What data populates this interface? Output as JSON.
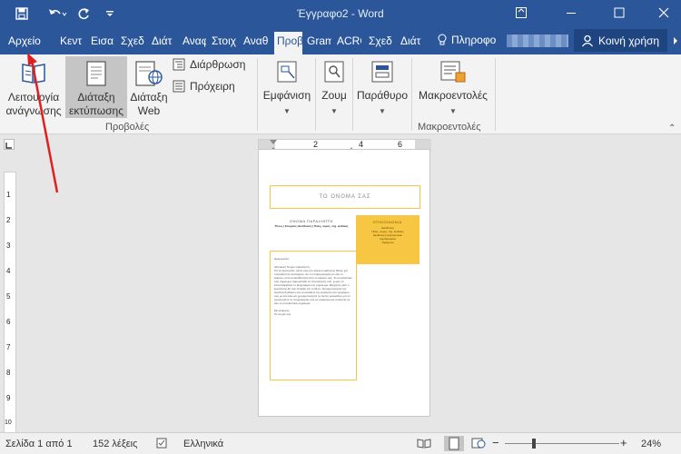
{
  "window": {
    "title": "Έγγραφο2 - Word"
  },
  "tabs": [
    "Αρχείο",
    "Κεντ",
    "Εισα",
    "Σχεδ",
    "Διάτ",
    "Αναφ",
    "Στοιχ",
    "Αναθ",
    "Προβ",
    "Gram",
    "ACRO",
    "Σχεδ",
    "Διάτ"
  ],
  "tell_me": "Πληροφο",
  "share_label": "Κοινή χρήση",
  "ribbon": {
    "read_mode": [
      "Λειτουργία",
      "ανάγνωσης"
    ],
    "print_layout": [
      "Διάταξη",
      "εκτύπωσης"
    ],
    "web_layout": [
      "Διάταξη",
      "Web"
    ],
    "outline": "Διάρθρωση",
    "draft": "Πρόχειρη",
    "views_group": "Προβολές",
    "show": "Εμφάνιση",
    "zoom": "Ζουμ",
    "window_btn": "Παράθυρο",
    "macros": "Μακροεντολές",
    "macros_group": "Μακροεντολές"
  },
  "ruler": {
    "h_marks": [
      "2",
      "4",
      "6"
    ],
    "v_marks": [
      "1",
      "2",
      "3",
      "4",
      "5",
      "6",
      "7",
      "8",
      "9",
      "10"
    ]
  },
  "doc": {
    "name": "ΤΟ ΟΝΟΜΑ ΣΑΣ",
    "recipient_title": "ΟΝΟΜΑ ΠΑΡΑΛΗΠΤΗ",
    "recipient_line": "Τίτλος | Εταιρεία | Διεύθυνση | Πόλη, νομός, ταχ. κώδικας",
    "contact_title": "ΕΠΙΚΟΙΝΩΝΙΑ",
    "contact_lines": [
      "Διεύθυνση",
      "Πόλη, νομός, ταχ. κώδικας",
      "Διεύθυνση ηλεκτρονικού",
      "ταχυδρομείου",
      "Τηλέφωνο"
    ],
    "date": "Ημερομηνία",
    "greeting": "Αξιότιμε/η Όνομα παραλήπτη,",
    "body": "Για να ξεκινήσετε, κάντε κλικ στο κείμενο κράτησης θέσης για οποιοδήποτε αντικείμενο. Αν το πληκτρολογείτε με όλο το κείμενο, αυτό αντικαθίσταται από το κείμενο σας. Το συνοδευτικό σας σημείωμα παρουσιάζει τις δυνατότητές σας, χωρίς να επαναλαμβάνει το βιογραφικό σας σημείωμα. Εξηγήστε γιατί ο εργοδότης θα σας επιλέξει για τη θέση. Χρησιμοποιήστε την καρτέλα Σχεδίαση για να αλλάξετε την εμφάνιση του εγγράφου σας με ένα κλικ και χρησιμοποιήστε τις λίστες κουκκίδων για να οργανώσετε τις πληροφορίες σας με σαφήνεια και συνέπεια σε όλο το συνοδευτικό σημείωμα.",
    "closing": "Με εκτίμηση,",
    "sign": "Το όνομά σας"
  },
  "status": {
    "page": "Σελίδα 1 από 1",
    "words": "152 λέξεις",
    "language": "Ελληνικά",
    "zoom": "24%"
  },
  "colors": {
    "word_blue": "#2b579a",
    "accent_yellow": "#f7c744",
    "arrow_red": "#e02020"
  }
}
